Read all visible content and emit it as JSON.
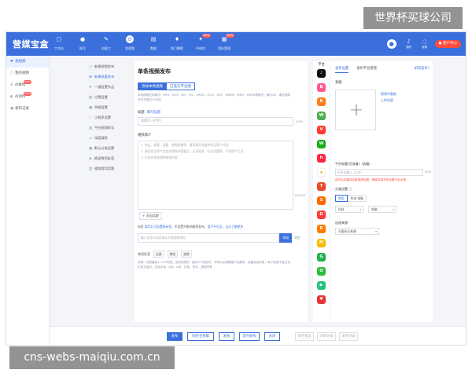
{
  "watermarks": {
    "top": "世界杯买球公司",
    "bottom": "cns-webs-maiqiu.com.cn"
  },
  "app": {
    "brand": "营媒宝盒"
  },
  "topnav": [
    {
      "icon": "▢",
      "label": "工作台"
    },
    {
      "icon": "●",
      "label": "账号"
    },
    {
      "icon": "✎",
      "label": "创意工"
    },
    {
      "icon": "⊙",
      "label": "发视频",
      "active": true
    },
    {
      "icon": "▤",
      "label": "数据"
    },
    {
      "icon": "♦",
      "label": "热门爆款"
    },
    {
      "icon": "✦",
      "label": "AI创作",
      "badge": "NEW"
    },
    {
      "icon": "▦",
      "label": "团队管理",
      "badge": "NEW"
    }
  ],
  "topright": {
    "avatar": "●",
    "notify_label": "通知",
    "service_label": "客服",
    "quit_label": "● 客户中心"
  },
  "sidebar": [
    {
      "icon": "✚",
      "label": "发视频",
      "active": true
    },
    {
      "icon": "▢",
      "label": "我的视频"
    },
    {
      "icon": "⊕",
      "label": "AI素材",
      "badge": "NEW"
    },
    {
      "icon": "◐",
      "label": "AI创作",
      "badge": "NEW"
    },
    {
      "icon": "▣",
      "label": "发布记录"
    }
  ],
  "menu": [
    {
      "icon": "▢",
      "label": "新建视频发布"
    },
    {
      "icon": "⊕",
      "label": "新建批量发布",
      "active": true
    },
    {
      "icon": "≡",
      "label": "一键设置作品"
    },
    {
      "icon": "▤",
      "label": "位置设置"
    },
    {
      "icon": "▣",
      "label": "同城设置"
    },
    {
      "icon": "♪",
      "label": "小程序设置"
    },
    {
      "icon": "▥",
      "label": "平台视频样式"
    },
    {
      "icon": "▭",
      "label": "深度搜索"
    },
    {
      "icon": "▦",
      "label": "默认分类设置"
    },
    {
      "icon": "◈",
      "label": "随读常用标签"
    },
    {
      "icon": "▤",
      "label": "视频常用话题"
    }
  ],
  "form": {
    "title": "单条视频发布",
    "tab_active": "添加本地视频",
    "tab_other": "已选云平台图",
    "hint": "本地视频支持格式：MP4、MOV、AVI、FLV、MPEG、OGG、3GP、WEBM、WMV、RMVB等格式，最大4G，建议视频时长不超过10分钟",
    "title_label": "标题",
    "title_link": "填写标题",
    "title_placeholder": "标题(1-30字)",
    "title_count": "0/30",
    "desc_label": "视频简介",
    "desc_placeholder_1": "1. 作品、标题、话题、视频投稿等，推荐填写完整的作品简介内容；",
    "desc_placeholder_2": "2. 建议作品简介应包含视频内容要点，以及标签、行业话题等，引导用户互动",
    "desc_placeholder_3": "3. 不含任何违规和敏感内容",
    "desc_count": "0/1000",
    "add_topic": "+ 添加话题",
    "tag_label": "标签",
    "tag_hint_1": "填写后可设置新标签，",
    "tag_hint_2": "不设置不影响推荐发布",
    "tag_hint_3": "，用户不可见，点击了解更多",
    "tag_placeholder": "输入自定义标签或从左侧选择添加",
    "tag_add": "添加",
    "tag_clear": "清空",
    "common_label": "常用标签",
    "common_chips": [
      "全部",
      "美妆",
      "旅游"
    ],
    "tips": "说明：标签最多2—6个标签，空间有限时，建议3个标签内；不同平台请根据平台要求，设置合适标签，每个标签不宜过长，中英文皆可。支持平台：B站、A站、抖音、快手、视频号等"
  },
  "platforms": {
    "header": "平台",
    "items": [
      {
        "icon": "♪",
        "color": "#111111"
      },
      {
        "icon": "B",
        "color": "#ff5c8a"
      },
      {
        "icon": "K",
        "color": "#ff7d1a"
      },
      {
        "icon": "W",
        "color": "#4caf50"
      },
      {
        "icon": "V",
        "color": "#ff3b30"
      },
      {
        "icon": "W",
        "color": "#1aad19"
      },
      {
        "icon": "h",
        "color": "#ff2442"
      },
      {
        "icon": "★",
        "color": "#ffffff"
      },
      {
        "icon": "T",
        "color": "#e94b2d"
      },
      {
        "icon": "S",
        "color": "#ff6a00"
      },
      {
        "icon": "D",
        "color": "#ff3a3a"
      },
      {
        "icon": "R",
        "color": "#ff7a00"
      },
      {
        "icon": "M",
        "color": "#f7bd00"
      },
      {
        "icon": "G",
        "color": "#22b14c"
      },
      {
        "icon": "O",
        "color": "#2fbd3c"
      },
      {
        "icon": "▶",
        "color": "#26c281"
      },
      {
        "icon": "♥",
        "color": "#e63535"
      }
    ]
  },
  "rpanel": {
    "tab_on": "发布设置",
    "tab_off": "发布平台管理",
    "link": "如何发布?",
    "cover_label": "封面",
    "cover_link_1": "视频中截取",
    "cover_link_2": "上传封面",
    "plat_title_label": "平台标题(可选填)（选填）",
    "plat_title_placeholder": "平台标题(1-30字)",
    "plat_title_count": "0/30",
    "red_1": "填写后标题将会覆盖原标题，确保您填写的标题不会出错",
    "red_2": "分类设置 ⓘ",
    "category_label": "分类设置 ⓘ",
    "seg_on": "常用",
    "seg_off": "科技·电脑",
    "sel_1": "科技",
    "sel_2": "电脑",
    "source_label": "自选来源",
    "source_value": "无需标注来源"
  },
  "footer": {
    "publish": "发布",
    "sync": "同步至草稿",
    "queue": "发布",
    "timed": "定时发布",
    "close": "关闭",
    "saved": "保存状态",
    "records": "同步记录",
    "history": "发布记录"
  }
}
